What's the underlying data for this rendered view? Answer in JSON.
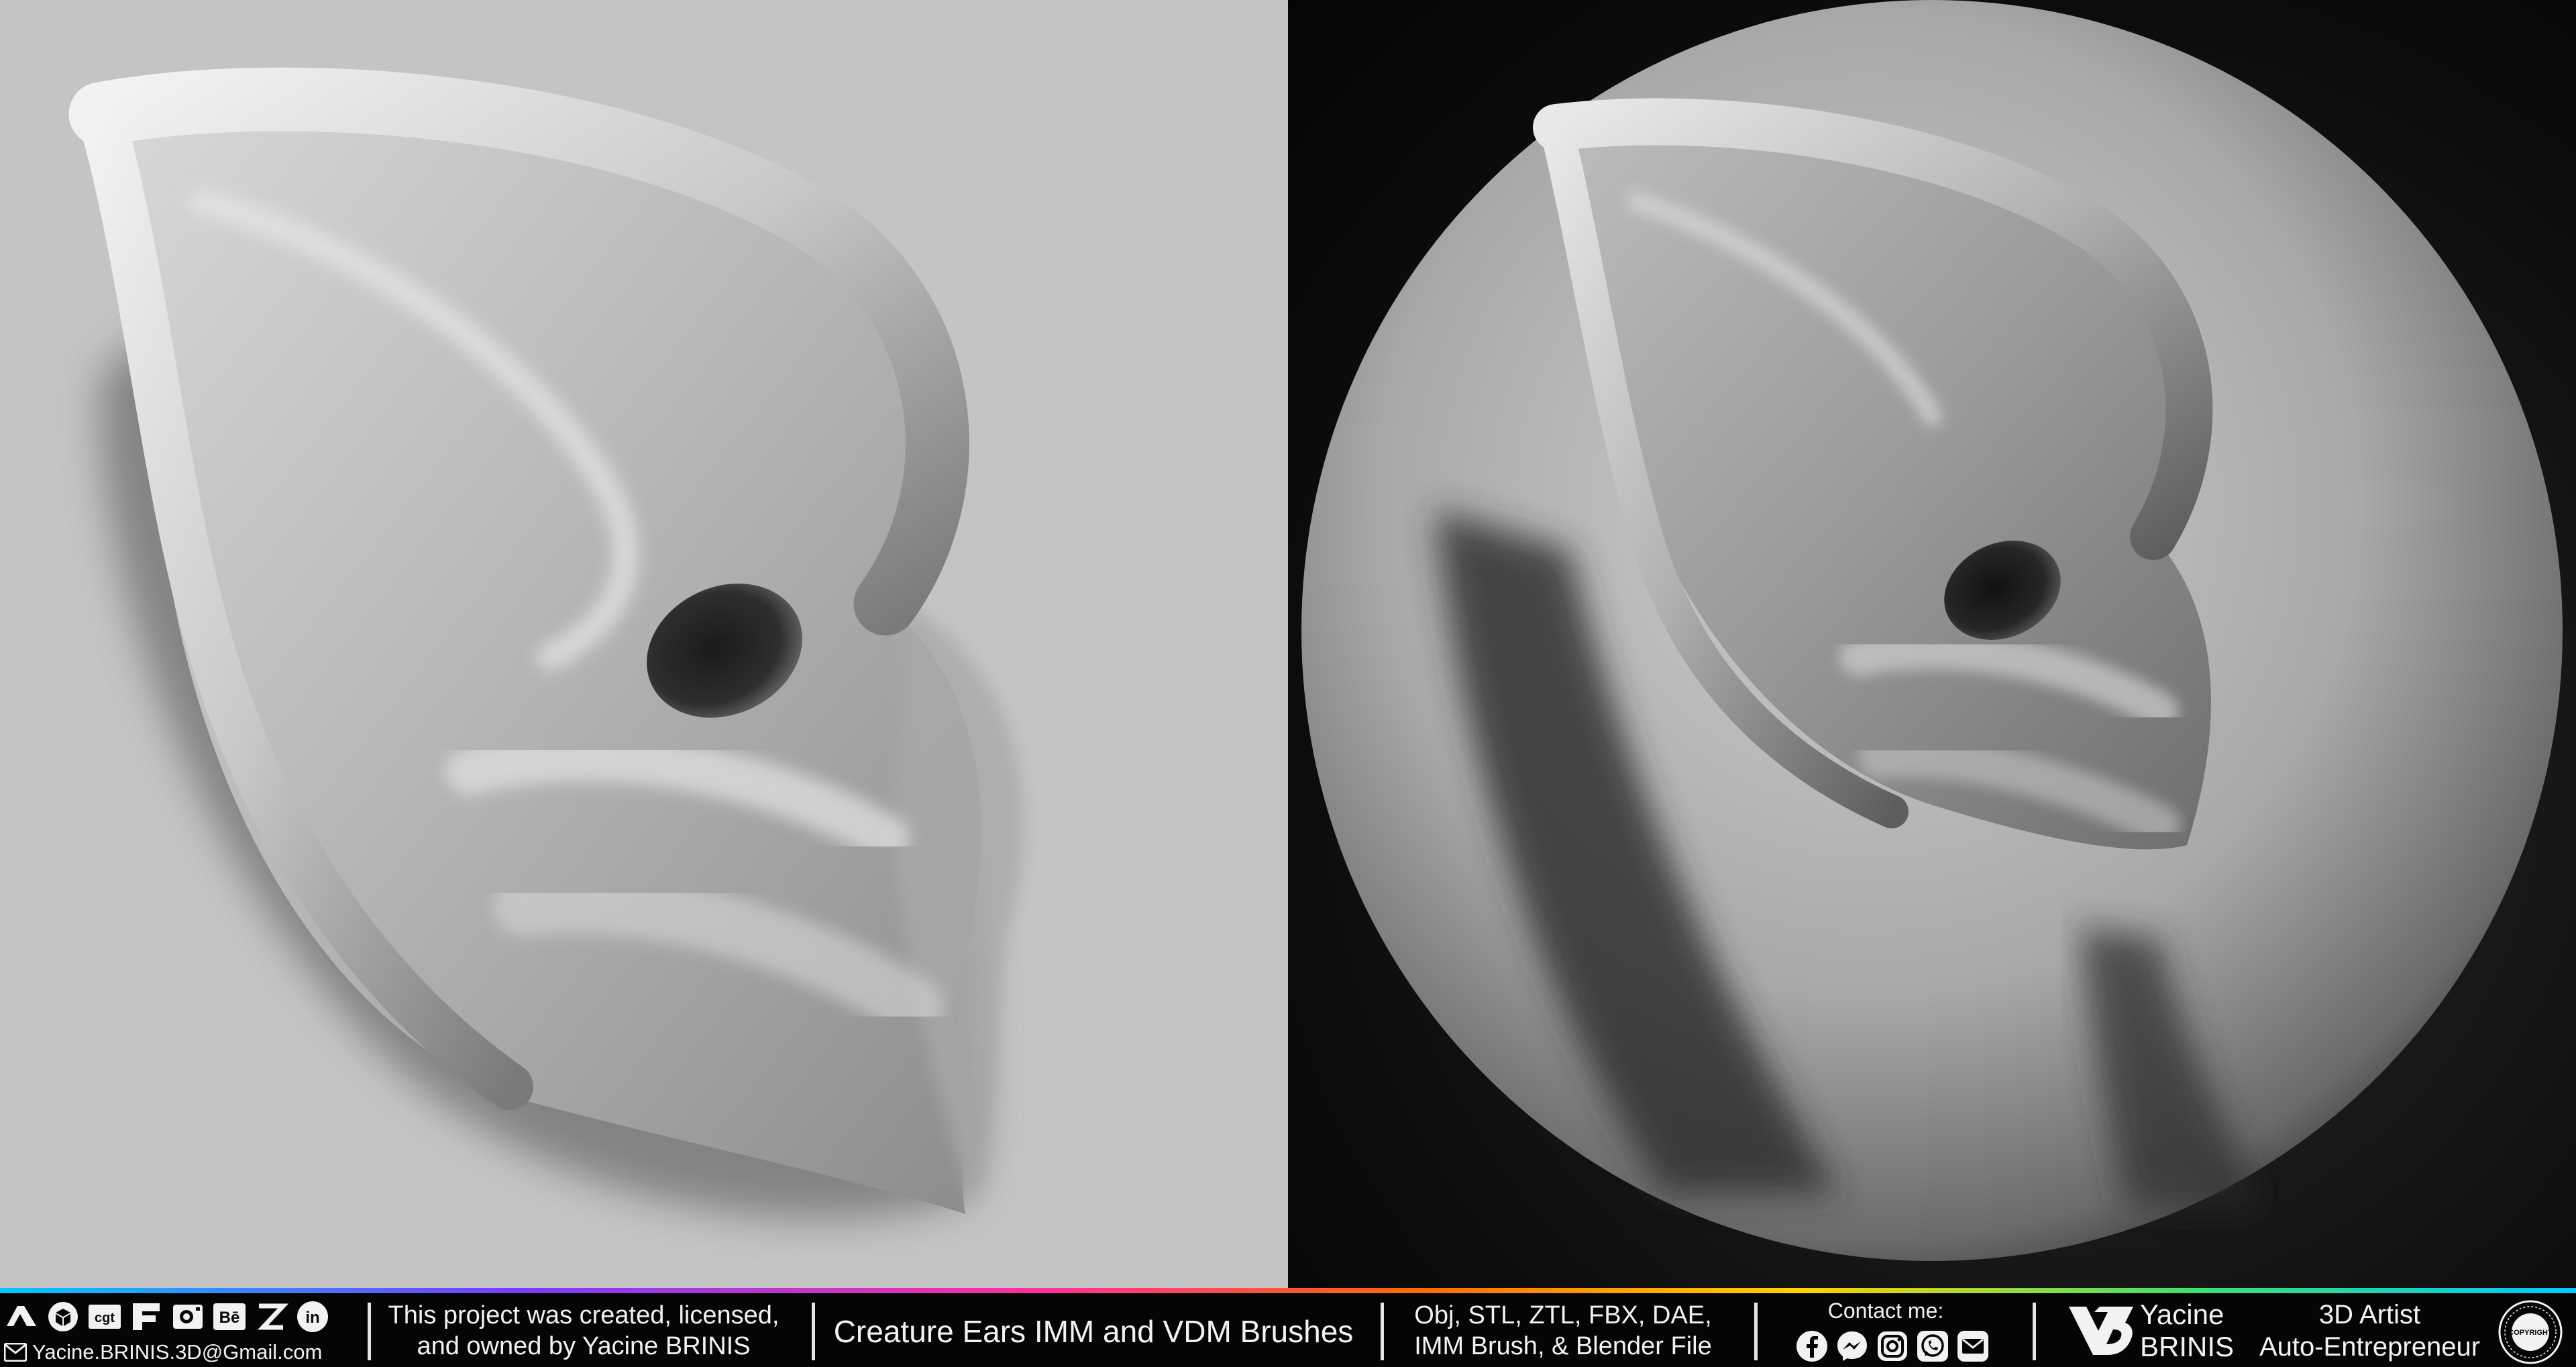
{
  "footer": {
    "platform_icons": [
      "artstation-icon",
      "sketchfab-icon",
      "cgtrader-icon",
      "fab-icon",
      "camera-icon",
      "behance-icon",
      "patreon-icon",
      "linkedin-icon"
    ],
    "cgt_label": "cgt",
    "be_label": "Bē",
    "in_label": "in",
    "email": "Yacine.BRINIS.3D@Gmail.com",
    "project_line1": "This project was created, licensed,",
    "project_line2": "and owned by Yacine BRINIS",
    "product_title": "Creature Ears IMM and VDM Brushes",
    "formats_line1": "Obj, STL, ZTL, FBX, DAE,",
    "formats_line2": "IMM Brush, & Blender File",
    "contact_label": "Contact me:",
    "contact_icons": [
      "facebook-icon",
      "messenger-icon",
      "instagram-icon",
      "whatsapp-icon",
      "mail-icon"
    ],
    "brand_first": "Yacine",
    "brand_last": "BRINIS",
    "role_line1": "3D Artist",
    "role_line2": "Auto-Entrepreneur",
    "copyright_label": "COPYRIGHT"
  },
  "colors": {
    "left_background": "#c4c4c4",
    "right_background": "#0c0c0c",
    "footer_background": "#050505",
    "footer_text": "#f2f2f2"
  }
}
